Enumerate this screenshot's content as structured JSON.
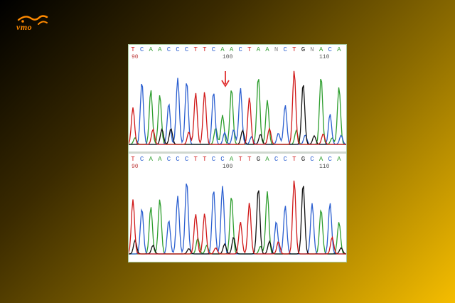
{
  "logo": {
    "text": "vmo"
  },
  "colors": {
    "A": "#2e9e2e",
    "C": "#2b5fd0",
    "G": "#111111",
    "T": "#d01818",
    "N": "#8a8a8a",
    "frame": "#a8c8a0",
    "arrow": "#e03030"
  },
  "panels": [
    {
      "sequence": "TCAACCCTTCAACTAANCTGNACA",
      "marker": "mutation-arrow",
      "positions": [
        {
          "label": "90",
          "index": 0,
          "red": true
        },
        {
          "label": "100",
          "index": 16,
          "red": false
        },
        {
          "label": "110",
          "index": 33,
          "red": false
        }
      ]
    },
    {
      "sequence": "TCAACCCTTCCATTGACCTGCACA",
      "positions": [
        {
          "label": "90",
          "index": 0,
          "red": true
        },
        {
          "label": "100",
          "index": 16,
          "red": false
        },
        {
          "label": "110",
          "index": 33,
          "red": false
        }
      ]
    }
  ]
}
